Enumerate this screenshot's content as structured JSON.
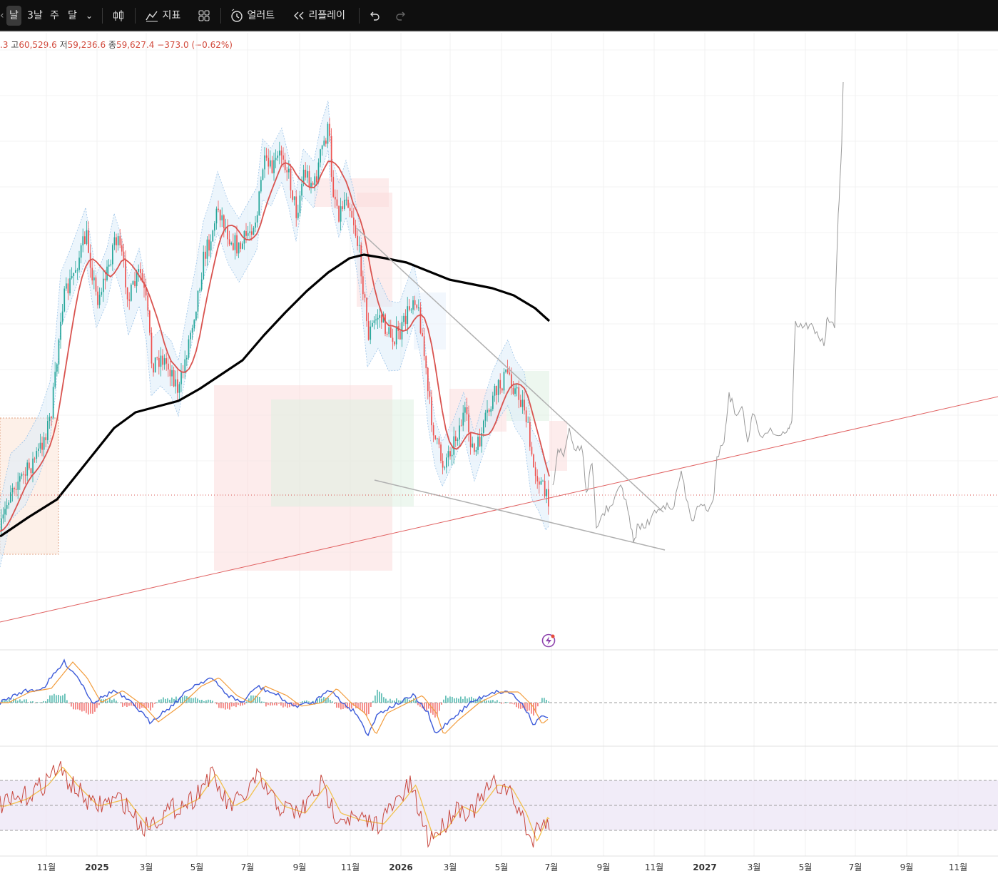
{
  "toolbar": {
    "timeframes": [
      "날",
      "3날",
      "주",
      "달"
    ],
    "active_timeframe": "날",
    "indicators_label": "지표",
    "alerts_label": "얼러트",
    "replay_label": "리플레이"
  },
  "legend": {
    "open_tail": ".3",
    "high_label": "고",
    "high_value": "60,529.6",
    "low_label": "저",
    "low_value": "59,236.6",
    "close_label": "종",
    "close_value": "59,627.4",
    "change": "−373.0 (−0.62%)"
  },
  "time_axis": [
    "11월",
    "2025",
    "3월",
    "5월",
    "7월",
    "9월",
    "11월",
    "2026",
    "3월",
    "5월",
    "7월",
    "9월",
    "11월",
    "2027",
    "3월",
    "5월",
    "7월",
    "9월",
    "11월"
  ],
  "colors": {
    "up": "#26a69a",
    "down": "#ef5350",
    "ma_red": "#d9534f",
    "ma_black": "#000000",
    "trend_red": "#e06060",
    "wedge": "#b0b0b0",
    "projection": "#9a9a9a",
    "macd_blue": "#3d5bd9",
    "macd_orange": "#f29b3a",
    "rsi_line": "#c8483f",
    "rsi_signal": "#f2c14e",
    "rsi_band": "#ede7f6",
    "lightning": "#8e44ad"
  }
}
